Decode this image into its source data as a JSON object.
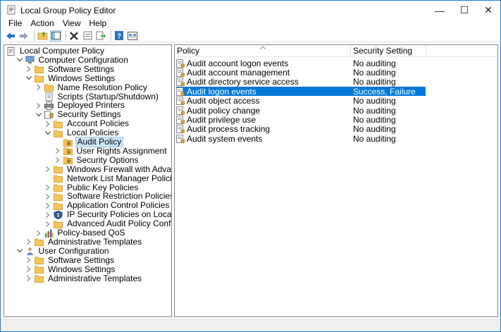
{
  "window": {
    "title": "Local Group Policy Editor",
    "controls": {
      "minimize": "—",
      "maximize": "☐",
      "close": "✕"
    }
  },
  "menu": [
    "File",
    "Action",
    "View",
    "Help"
  ],
  "toolbar": [
    "back-arrow-icon",
    "forward-arrow-icon",
    "up-folder-icon",
    "show-hide-tree-icon",
    "delete-icon",
    "properties-icon",
    "export-icon",
    "help-icon",
    "view-icon"
  ],
  "tree": [
    {
      "label": "Local Computer Policy",
      "level": 0,
      "exp": "",
      "icon": "policy-doc-icon"
    },
    {
      "label": "Computer Configuration",
      "level": 1,
      "exp": "open",
      "icon": "computer-icon"
    },
    {
      "label": "Software Settings",
      "level": 2,
      "exp": "closed",
      "icon": "folder-icon"
    },
    {
      "label": "Windows Settings",
      "level": 2,
      "exp": "open",
      "icon": "folder-icon"
    },
    {
      "label": "Name Resolution Policy",
      "level": 3,
      "exp": "closed",
      "icon": "folder-icon"
    },
    {
      "label": "Scripts (Startup/Shutdown)",
      "level": 3,
      "exp": "",
      "icon": "script-icon"
    },
    {
      "label": "Deployed Printers",
      "level": 3,
      "exp": "closed",
      "icon": "printer-icon"
    },
    {
      "label": "Security Settings",
      "level": 3,
      "exp": "open",
      "icon": "security-settings-icon"
    },
    {
      "label": "Account Policies",
      "level": 4,
      "exp": "closed",
      "icon": "folder-icon"
    },
    {
      "label": "Local Policies",
      "level": 4,
      "exp": "open",
      "icon": "folder-icon"
    },
    {
      "label": "Audit Policy",
      "level": 5,
      "exp": "",
      "icon": "locked-folder-icon",
      "selected": true
    },
    {
      "label": "User Rights Assignment",
      "level": 5,
      "exp": "closed",
      "icon": "locked-folder-icon"
    },
    {
      "label": "Security Options",
      "level": 5,
      "exp": "closed",
      "icon": "locked-folder-icon"
    },
    {
      "label": "Windows Firewall with Advanced Security",
      "level": 4,
      "exp": "closed",
      "icon": "folder-icon"
    },
    {
      "label": "Network List Manager Policies",
      "level": 4,
      "exp": "",
      "icon": "folder-icon"
    },
    {
      "label": "Public Key Policies",
      "level": 4,
      "exp": "closed",
      "icon": "folder-icon"
    },
    {
      "label": "Software Restriction Policies",
      "level": 4,
      "exp": "closed",
      "icon": "folder-icon"
    },
    {
      "label": "Application Control Policies",
      "level": 4,
      "exp": "closed",
      "icon": "folder-icon"
    },
    {
      "label": "IP Security Policies on Local Computer",
      "level": 4,
      "exp": "closed",
      "icon": "ip-security-icon"
    },
    {
      "label": "Advanced Audit Policy Configuration",
      "level": 4,
      "exp": "closed",
      "icon": "folder-icon"
    },
    {
      "label": "Policy-based QoS",
      "level": 3,
      "exp": "closed",
      "icon": "chart-icon"
    },
    {
      "label": "Administrative Templates",
      "level": 2,
      "exp": "closed",
      "icon": "folder-icon"
    },
    {
      "label": "User Configuration",
      "level": 1,
      "exp": "open",
      "icon": "user-icon"
    },
    {
      "label": "Software Settings",
      "level": 2,
      "exp": "closed",
      "icon": "folder-icon"
    },
    {
      "label": "Windows Settings",
      "level": 2,
      "exp": "closed",
      "icon": "folder-icon"
    },
    {
      "label": "Administrative Templates",
      "level": 2,
      "exp": "closed",
      "icon": "folder-icon"
    }
  ],
  "list": {
    "columns": [
      "Policy",
      "Security Setting"
    ],
    "rows": [
      {
        "policy": "Audit account logon events",
        "setting": "No auditing"
      },
      {
        "policy": "Audit account management",
        "setting": "No auditing"
      },
      {
        "policy": "Audit directory service access",
        "setting": "No auditing"
      },
      {
        "policy": "Audit logon events",
        "setting": "Success, Failure",
        "selected": true
      },
      {
        "policy": "Audit object access",
        "setting": "No auditing"
      },
      {
        "policy": "Audit policy change",
        "setting": "No auditing"
      },
      {
        "policy": "Audit privilege use",
        "setting": "No auditing"
      },
      {
        "policy": "Audit process tracking",
        "setting": "No auditing"
      },
      {
        "policy": "Audit system events",
        "setting": "No auditing"
      }
    ]
  },
  "colors": {
    "selection": "#0078d7",
    "tree_selection": "#cce8ff",
    "folder": "#f5c55a",
    "window_border": "#1883d7"
  }
}
